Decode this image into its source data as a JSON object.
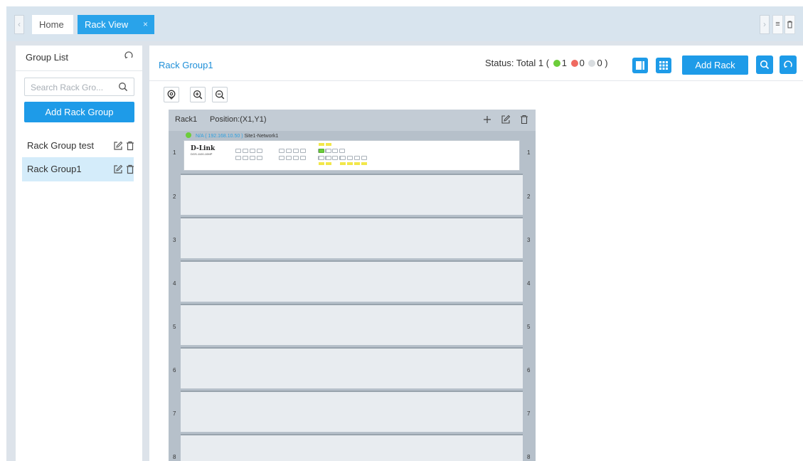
{
  "tabs": {
    "home": "Home",
    "active": "Rack View",
    "close_glyph": "×",
    "prev_glyph": "‹",
    "next_glyph": "›",
    "menu_glyph": "≡",
    "delete_icon": "trash-icon"
  },
  "group_list": {
    "title": "Group List",
    "search_placeholder": "Search Rack Gro...",
    "add_button": "Add Rack Group",
    "items": [
      {
        "label": "Rack Group test",
        "selected": false
      },
      {
        "label": "Rack Group1",
        "selected": true
      }
    ]
  },
  "main": {
    "title": "Rack Group1",
    "status": {
      "prefix": "Status: Total 1 (",
      "green": "1",
      "red": "0",
      "gray": "0",
      "suffix": ")"
    },
    "add_rack": "Add Rack",
    "colors": {
      "accent": "#1e9be8",
      "green": "#6ccd3a",
      "red": "#ef6a61",
      "gray": "#d9dde0"
    }
  },
  "rack": {
    "name": "Rack1",
    "position": "Position:(X1,Y1)",
    "slots": [
      "1",
      "2",
      "3",
      "4",
      "5",
      "6",
      "7",
      "8"
    ],
    "device": {
      "name": "N/A",
      "ip": "( 192.168.10.50 )",
      "site": "Site1-Network1",
      "brand": "D-Link",
      "model": "DGS-1100-10MP",
      "status": "online"
    }
  }
}
